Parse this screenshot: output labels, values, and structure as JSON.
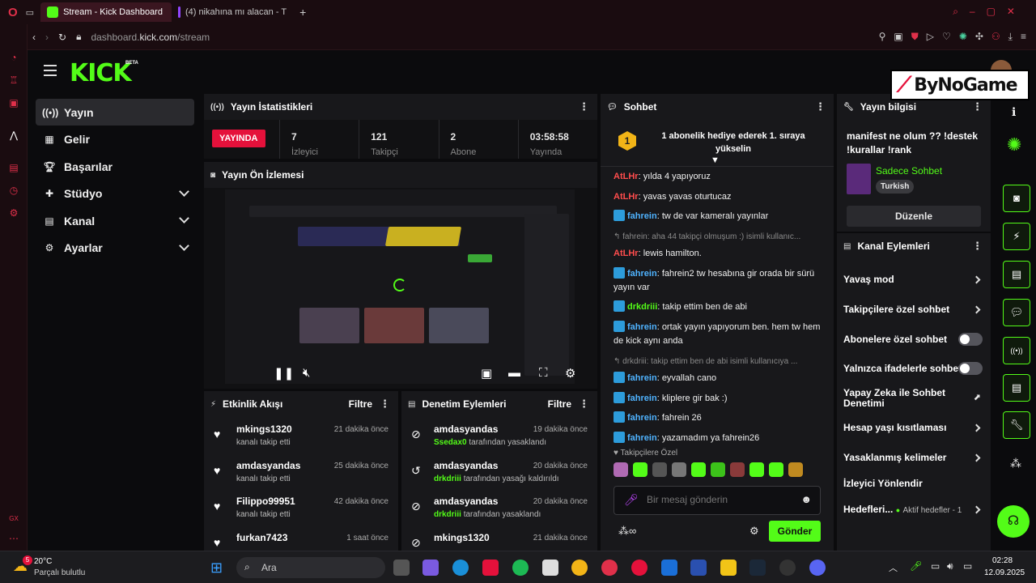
{
  "browser": {
    "tabs": [
      {
        "label": "Stream - Kick Dashboard",
        "active": true,
        "color": "#53fc18"
      },
      {
        "label": "(4) nikahına mı alacan - T",
        "active": false,
        "color": "#9146ff"
      }
    ],
    "url_prefix": "dashboard.",
    "url_host": "kick.com",
    "url_path": "/stream"
  },
  "brand": {
    "logo": "KICK",
    "beta": "BETA",
    "accent": "#53fc18"
  },
  "nav": [
    {
      "label": "Yayın",
      "icon": "broadcast-icon",
      "active": true,
      "expandable": false
    },
    {
      "label": "Gelir",
      "icon": "revenue-icon",
      "active": false,
      "expandable": false
    },
    {
      "label": "Başarılar",
      "icon": "trophy-icon",
      "active": false,
      "expandable": false
    },
    {
      "label": "Stüdyo",
      "icon": "studio-icon",
      "active": false,
      "expandable": true
    },
    {
      "label": "Kanal",
      "icon": "channel-icon",
      "active": false,
      "expandable": true
    },
    {
      "label": "Ayarlar",
      "icon": "gear-icon",
      "active": false,
      "expandable": true
    }
  ],
  "stats": {
    "title": "Yayın İstatistikleri",
    "live_label": "YAYINDA",
    "live_color": "#e5113b",
    "items": [
      {
        "value": "7",
        "label": "İzleyici"
      },
      {
        "value": "121",
        "label": "Takipçi"
      },
      {
        "value": "2",
        "label": "Abone"
      },
      {
        "value": "03:58:58",
        "label": "Yayında"
      }
    ]
  },
  "preview": {
    "title": "Yayın Ön İzlemesi"
  },
  "activity": {
    "title": "Etkinlik Akışı",
    "filter": "Filtre",
    "items": [
      {
        "name": "mkings1320",
        "action": "kanalı takip etti",
        "time": "21 dakika önce"
      },
      {
        "name": "amdasyandas",
        "action": "kanalı takip etti",
        "time": "25 dakika önce"
      },
      {
        "name": "Filippo99951",
        "action": "kanalı takip etti",
        "time": "42 dakika önce"
      },
      {
        "name": "furkan7423",
        "action": "",
        "time": "1 saat önce"
      }
    ]
  },
  "moderation": {
    "title": "Denetim Eylemleri",
    "filter": "Filtre",
    "items": [
      {
        "name": "amdasyandas",
        "by": "Ssedax0",
        "action": "tarafından yasaklandı",
        "time": "19 dakika önce",
        "icon": "ban-icon"
      },
      {
        "name": "amdasyandas",
        "by": "drkdriii",
        "action": "tarafından yasağı kaldırıldı",
        "time": "20 dakika önce",
        "icon": "undo-icon"
      },
      {
        "name": "amdasyandas",
        "by": "drkdriii",
        "action": "tarafından yasaklandı",
        "time": "20 dakika önce",
        "icon": "ban-icon"
      },
      {
        "name": "mkings1320",
        "by": "",
        "action": "",
        "time": "21 dakika önce",
        "icon": "ban-icon"
      }
    ]
  },
  "chat": {
    "title": "Sohbet",
    "banner": "1 abonelik hediye ederek 1. sıraya yükselin",
    "banner_rank": "1",
    "messages": [
      {
        "user": "AtLHr",
        "color": "#ff4d4d",
        "text": "yılda 4 yapıyoruz",
        "badge": false,
        "reply": false
      },
      {
        "user": "AtLHr",
        "color": "#ff4d4d",
        "text": "yavas yavas oturtucaz",
        "badge": false,
        "reply": false
      },
      {
        "user": "fahrein",
        "color": "#4fb3ff",
        "text": "tw de var kameralı yayınlar",
        "badge": true,
        "reply": false
      },
      {
        "user": "",
        "color": "#8a8a8a",
        "text": "↰ fahrein: aha 44 takipçi olmuşum :) isimli kullanıc...",
        "badge": false,
        "reply": true
      },
      {
        "user": "AtLHr",
        "color": "#ff4d4d",
        "text": "lewis hamilton.",
        "badge": false,
        "reply": false
      },
      {
        "user": "fahrein",
        "color": "#4fb3ff",
        "text": "fahrein2 tw hesabına gir orada bir sürü yayın var",
        "badge": true,
        "reply": false
      },
      {
        "user": "drkdriii",
        "color": "#53fc18",
        "text": "takip ettim ben de abi",
        "badge": true,
        "reply": false
      },
      {
        "user": "fahrein",
        "color": "#4fb3ff",
        "text": "ortak yayın yapıyorum ben. hem tw hem de kick aynı anda",
        "badge": true,
        "reply": false
      },
      {
        "user": "",
        "color": "#8a8a8a",
        "text": "↰ drkdriii: takip ettim ben de abi isimli kullanıcıya ...",
        "badge": false,
        "reply": true
      },
      {
        "user": "fahrein",
        "color": "#4fb3ff",
        "text": "eyvallah cano",
        "badge": true,
        "reply": false
      },
      {
        "user": "fahrein",
        "color": "#4fb3ff",
        "text": "kliplere gir bak :)",
        "badge": true,
        "reply": false
      },
      {
        "user": "fahrein",
        "color": "#4fb3ff",
        "text": "fahrein 26",
        "badge": true,
        "reply": false
      },
      {
        "user": "fahrein",
        "color": "#4fb3ff",
        "text": "yazamadım ya fahrein26",
        "badge": true,
        "reply": false
      }
    ],
    "followers_only": "♥ Takipçilere Özel",
    "input_placeholder": "Bir mesaj gönderin",
    "send_label": "Gönder"
  },
  "stream_info": {
    "title": "Yayın bilgisi",
    "stream_title": "manifest ne olum ?? !destek !kurallar !rank",
    "category": "Sadece Sohbet",
    "category_color": "#53fc18",
    "language": "Turkish",
    "edit_label": "Düzenle"
  },
  "channel_actions": {
    "title": "Kanal Eylemleri",
    "items": [
      {
        "label": "Yavaş mod",
        "control": "chevron"
      },
      {
        "label": "Takipçilere özel sohbet",
        "control": "chevron"
      },
      {
        "label": "Abonelere özel sohbet",
        "control": "toggle"
      },
      {
        "label": "Yalnızca ifadelerle sohbet",
        "control": "toggle"
      },
      {
        "label": "Yapay Zeka ile Sohbet Denetimi",
        "control": "external"
      },
      {
        "label": "Hesap yaşı kısıtlaması",
        "control": "chevron"
      },
      {
        "label": "Yasaklanmış kelimeler",
        "control": "chevron"
      },
      {
        "label": "İzleyici Yönlendir",
        "control": "none"
      },
      {
        "label": "Hedefleri...",
        "control": "chevron",
        "extra": "Aktif hedefler - 1"
      }
    ]
  },
  "watermark": {
    "text": "ByNoGame"
  },
  "taskbar": {
    "weather_temp": "20°C",
    "weather_desc": "Parçalı bulutlu",
    "weather_alert": "5",
    "search_placeholder": "Ara",
    "time": "02:28",
    "date": "12.09.2025"
  }
}
